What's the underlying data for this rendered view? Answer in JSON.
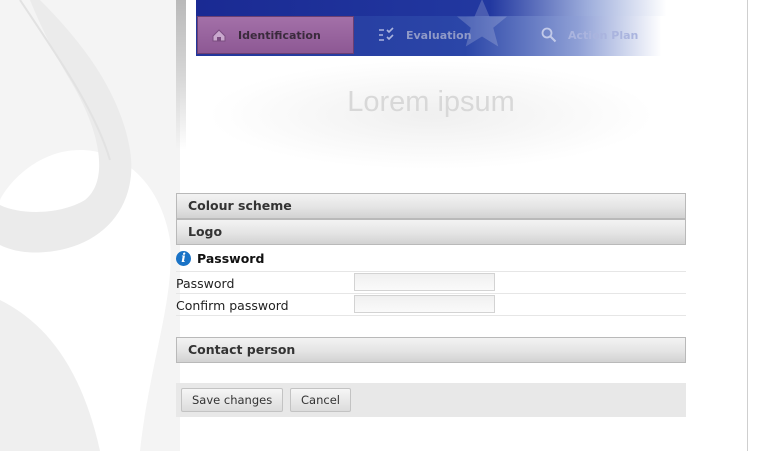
{
  "nav": {
    "tabs": [
      {
        "label": "Identification",
        "icon": "house-icon",
        "active": true
      },
      {
        "label": "Evaluation",
        "icon": "checklist-icon",
        "active": false
      },
      {
        "label": "Action Plan",
        "icon": "magnifier-icon",
        "active": false
      }
    ]
  },
  "header": {
    "title": "Lorem ipsum"
  },
  "sections": {
    "colour_scheme": "Colour scheme",
    "logo": "Logo",
    "password": {
      "title": "Password",
      "info_icon": "i",
      "fields": [
        {
          "label": "Password",
          "value": ""
        },
        {
          "label": "Confirm password",
          "value": ""
        }
      ]
    },
    "contact_person": "Contact person"
  },
  "actions": {
    "save": "Save changes",
    "cancel": "Cancel"
  },
  "colors": {
    "banner": "#22369b",
    "active_tab": "#9a66a1",
    "info_icon": "#1a73c6"
  }
}
